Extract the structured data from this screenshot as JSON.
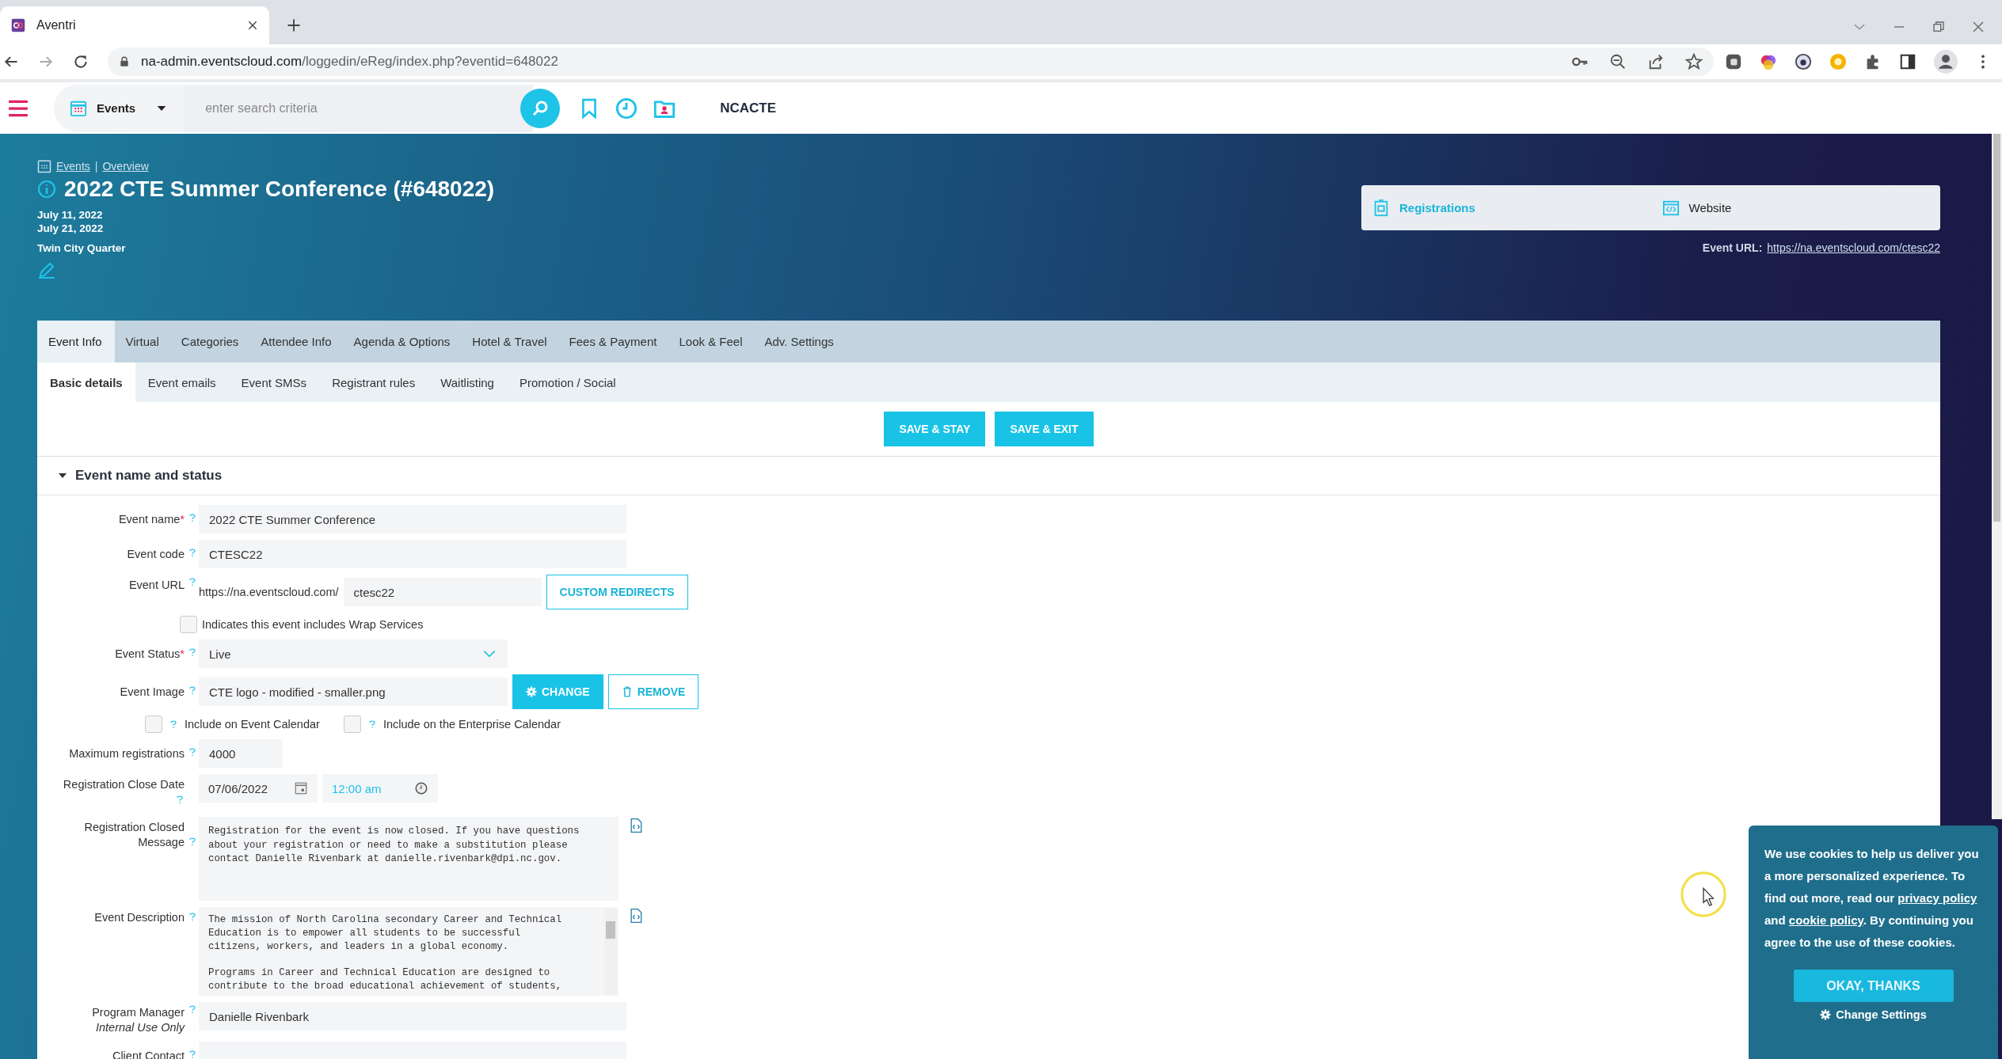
{
  "browser": {
    "tab_title": "Aventri",
    "url_host": "na-admin.eventscloud.com",
    "url_path": "/loggedin/eReg/index.php?eventid=648022"
  },
  "app_header": {
    "module": "Events",
    "search_placeholder": "enter search criteria",
    "account": "NCACTE"
  },
  "event": {
    "breadcrumb": [
      "Events",
      "Overview"
    ],
    "breadcrumb_separator": "|",
    "title": "2022 CTE Summer Conference (#648022)",
    "start_date": "July 11, 2022",
    "end_date": "July 21, 2022",
    "venue": "Twin City Quarter"
  },
  "quick_links": [
    {
      "label": "Registrations",
      "selected": true
    },
    {
      "label": "Website",
      "selected": false
    }
  ],
  "event_url": {
    "label": "Event URL:",
    "value": "https://na.eventscloud.com/ctesc22"
  },
  "tabs": [
    {
      "label": "Event Info",
      "selected": true
    },
    {
      "label": "Virtual",
      "selected": false
    },
    {
      "label": "Categories",
      "selected": false
    },
    {
      "label": "Attendee Info",
      "selected": false
    },
    {
      "label": "Agenda & Options",
      "selected": false
    },
    {
      "label": "Hotel & Travel",
      "selected": false
    },
    {
      "label": "Fees & Payment",
      "selected": false
    },
    {
      "label": "Look & Feel",
      "selected": false
    },
    {
      "label": "Adv. Settings",
      "selected": false
    }
  ],
  "subtabs": [
    {
      "label": "Basic details",
      "selected": true
    },
    {
      "label": "Event emails",
      "selected": false
    },
    {
      "label": "Event SMSs",
      "selected": false
    },
    {
      "label": "Registrant rules",
      "selected": false
    },
    {
      "label": "Waitlisting",
      "selected": false
    },
    {
      "label": "Promotion / Social",
      "selected": false
    }
  ],
  "actions": [
    "SAVE & STAY",
    "SAVE & EXIT"
  ],
  "section": {
    "title": "Event name and status",
    "expanded": true
  },
  "fields": [
    {
      "kind": "text",
      "label": "Event name",
      "required_mark": "*",
      "value": "2022 CTE Summer Conference"
    },
    {
      "kind": "text",
      "label": "Event code",
      "value": "CTESC22"
    },
    {
      "kind": "url",
      "label": "Event URL",
      "prefix": "https://na.eventscloud.com/",
      "value": "ctesc22",
      "button": "CUSTOM REDIRECTS"
    },
    {
      "kind": "checkbox",
      "label": "Indicates this event includes Wrap Services",
      "checked": false
    },
    {
      "kind": "select",
      "label": "Event Status",
      "required_mark": "*",
      "value": "Live"
    },
    {
      "kind": "image",
      "label": "Event Image",
      "value": "CTE logo - modified - smaller.png",
      "buttons": [
        "CHANGE",
        "REMOVE"
      ]
    },
    {
      "kind": "checkbox_pair",
      "items": [
        {
          "label": "Include on Event Calendar",
          "checked": false
        },
        {
          "label": "Include on the Enterprise Calendar",
          "checked": false
        }
      ]
    },
    {
      "kind": "number",
      "label": "Maximum registrations",
      "value": "4000"
    },
    {
      "kind": "datetime",
      "label": "Registration Close Date",
      "date": "07/06/2022",
      "time": "12:00 am"
    },
    {
      "kind": "textarea",
      "label": "Registration Closed Message",
      "value": "Registration for the event is now closed. If you have questions\nabout your registration or need to make a substitution please\ncontact Danielle Rivenbark at danielle.rivenbark@dpi.nc.gov."
    },
    {
      "kind": "long_textarea",
      "label": "Event Description",
      "value": "The mission of North Carolina secondary Career and Technical\nEducation is to empower all students to be successful\ncitizens, workers, and leaders in a global economy.\n\nPrograms in Career and Technical Education are designed to\ncontribute to the broad educational achievement of students,"
    },
    {
      "kind": "text",
      "label": "Program Manager",
      "note": "Internal Use Only",
      "value": "Danielle Rivenbark"
    },
    {
      "kind": "text",
      "label": "Client Contact"
    }
  ],
  "cookie_banner": {
    "text_before": "We use cookies to help us deliver you a more personalized experience. To find out more, read our",
    "links": [
      "privacy policy",
      "cookie policy"
    ],
    "text_between": "and",
    "text_after": ". By continuing you agree to the use of these cookies.",
    "button": "OKAY, THANKS",
    "settings": "Change Settings"
  }
}
